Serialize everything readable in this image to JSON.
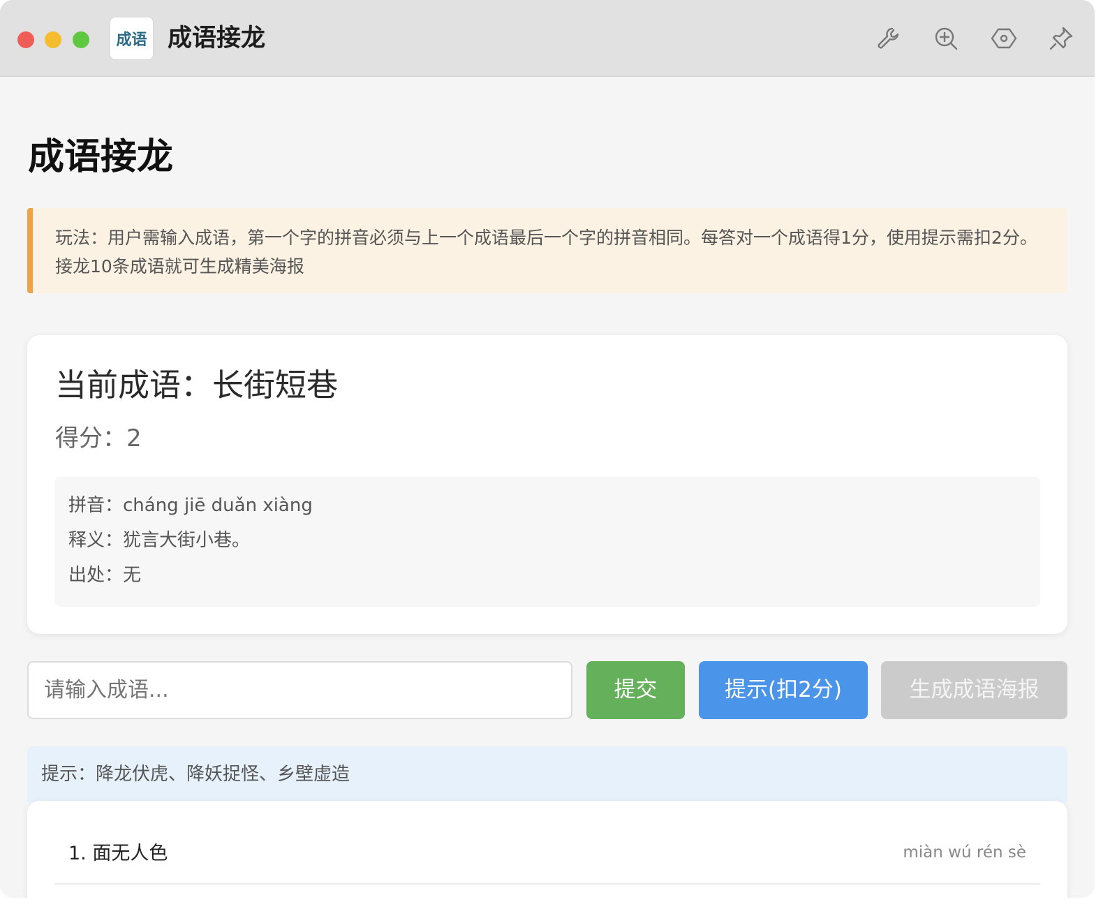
{
  "window": {
    "app_title": "成语接龙",
    "logo_text": "成语"
  },
  "toolbar": {
    "icons": [
      "wrench-icon",
      "zoom-in-icon",
      "hexagon-settings-icon",
      "pin-icon"
    ]
  },
  "page": {
    "title": "成语接龙",
    "rules": "玩法：用户需输入成语，第一个字的拼音必须与上一个成语最后一个字的拼音相同。每答对一个成语得1分，使用提示需扣2分。接龙10条成语就可生成精美海报"
  },
  "game": {
    "current_label": "当前成语：长街短巷",
    "score_label": "得分：2",
    "pinyin_line": "拼音：cháng jiē duǎn xiàng",
    "meaning_line": "释义：犹言大街小巷。",
    "source_line": "出处：无"
  },
  "controls": {
    "input_placeholder": "请输入成语...",
    "submit_label": "提交",
    "hint_label": "提示(扣2分)",
    "poster_label": "生成成语海报"
  },
  "hint_text": "提示：降龙伏虎、降妖捉怪、乡壁虚造",
  "history": [
    {
      "idiom": "1. 面无人色",
      "pinyin": "miàn wú rén sè"
    }
  ],
  "colors": {
    "accent_orange": "#f0a246",
    "submit_green": "#65b05b",
    "hint_blue": "#4a94ea",
    "poster_disabled": "#cbcbcb"
  }
}
